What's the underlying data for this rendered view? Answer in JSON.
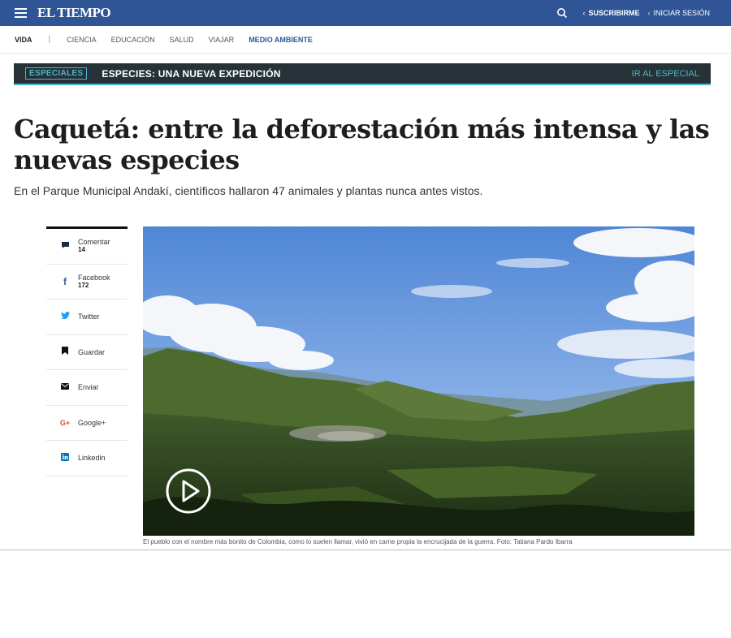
{
  "header": {
    "menu_icon": "hamburger-icon",
    "logo": "EL TIEMPO",
    "search_icon": "search-icon",
    "subscribe": "SUSCRIBIRME",
    "login": "INICIAR SESIÓN",
    "color": "#2f5597"
  },
  "section_nav": {
    "main": "VIDA",
    "separator": "|",
    "items": [
      "CIENCIA",
      "EDUCACIÓN",
      "SALUD",
      "VIAJAR",
      "MEDIO AMBIENTE"
    ],
    "active": "MEDIO AMBIENTE"
  },
  "special_banner": {
    "badge": "ESPECIALES",
    "title": "ESPECIES: UNA NUEVA EXPEDICIÓN",
    "link": "IR AL ESPECIAL",
    "accent": "#4fb3c9"
  },
  "article": {
    "title": "Caquetá: entre la deforestación más intensa y las nuevas especies",
    "subtitle": "En el Parque Municipal Andakí, científicos hallaron 47 animales y plantas nunca antes vistos.",
    "caption": "El pueblo con el nombre más bonito de Colombia, como lo suelen llamar, vivió en carne propia la encrucijada de la guerra. Foto: Tatiana Pardo Ibarra"
  },
  "share": [
    {
      "label": "Comentar",
      "count": "14",
      "icon": "comment-icon"
    },
    {
      "label": "Facebook",
      "count": "172",
      "icon": "facebook-icon"
    },
    {
      "label": "Twitter",
      "count": "",
      "icon": "twitter-icon"
    },
    {
      "label": "Guardar",
      "count": "",
      "icon": "bookmark-icon"
    },
    {
      "label": "Enviar",
      "count": "",
      "icon": "mail-icon"
    },
    {
      "label": "Google+",
      "count": "",
      "icon": "google-plus-icon"
    },
    {
      "label": "Linkedin",
      "count": "",
      "icon": "linkedin-icon"
    }
  ]
}
